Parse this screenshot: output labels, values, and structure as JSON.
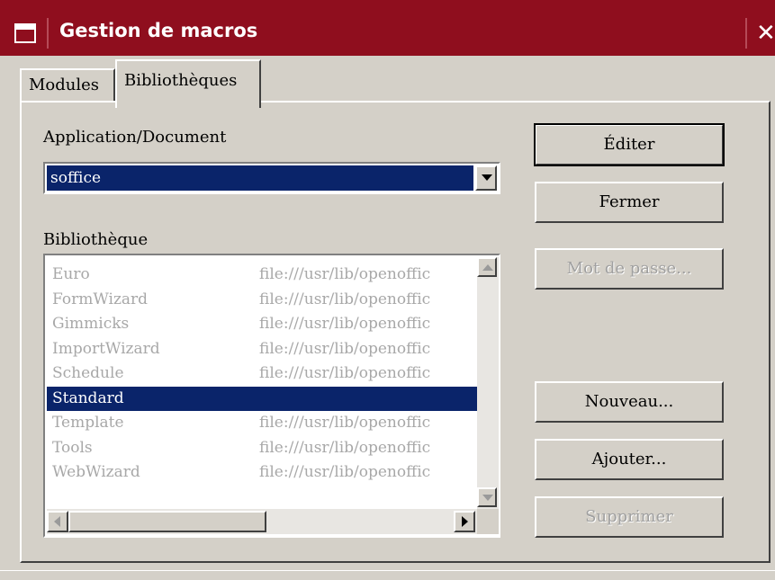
{
  "window": {
    "title": "Gestion de macros",
    "close_glyph": "✕"
  },
  "tabs": [
    {
      "label": "Modules",
      "selected": false
    },
    {
      "label": "Bibliothèques",
      "selected": true
    }
  ],
  "application": {
    "label": "Application/Document",
    "value": "soffice"
  },
  "library": {
    "label": "Bibliothèque",
    "items": [
      {
        "name": "Euro",
        "path": "file:///usr/lib/openoffic"
      },
      {
        "name": "FormWizard",
        "path": "file:///usr/lib/openoffic"
      },
      {
        "name": "Gimmicks",
        "path": "file:///usr/lib/openoffic"
      },
      {
        "name": "ImportWizard",
        "path": "file:///usr/lib/openoffic"
      },
      {
        "name": "Schedule",
        "path": "file:///usr/lib/openoffic"
      },
      {
        "name": "Standard",
        "path": ""
      },
      {
        "name": "Template",
        "path": "file:///usr/lib/openoffic"
      },
      {
        "name": "Tools",
        "path": "file:///usr/lib/openoffic"
      },
      {
        "name": "WebWizard",
        "path": "file:///usr/lib/openoffic"
      }
    ],
    "selected_index": 5
  },
  "buttons": {
    "editer": "Éditer",
    "fermer": "Fermer",
    "mot_de_passe": "Mot de passe...",
    "nouveau": "Nouveau...",
    "ajouter": "Ajouter...",
    "supprimer": "Supprimer"
  },
  "colors": {
    "titlebar": "#8f0e1e",
    "selection": "#0a246a",
    "face": "#d4d0c8"
  }
}
